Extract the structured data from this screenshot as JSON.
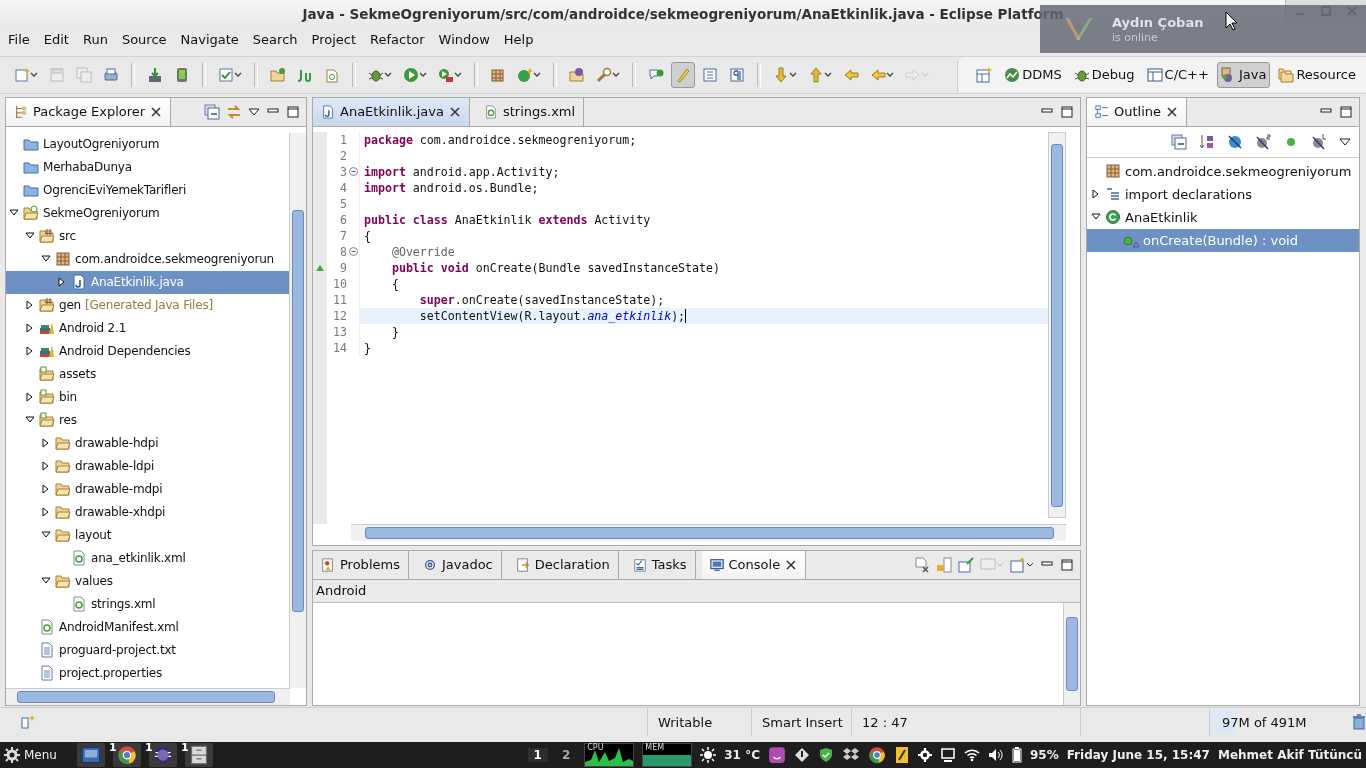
{
  "window": {
    "title": "Java - SekmeOgreniyorum/src/com/androidce/sekmeogreniyorum/AnaEtkinlik.java - Eclipse Platform"
  },
  "notification": {
    "name": "Aydın Çoban",
    "status": "is online"
  },
  "menu": [
    {
      "label": "File"
    },
    {
      "label": "Edit"
    },
    {
      "label": "Run"
    },
    {
      "label": "Source"
    },
    {
      "label": "Navigate"
    },
    {
      "label": "Search"
    },
    {
      "label": "Project"
    },
    {
      "label": "Refactor"
    },
    {
      "label": "Window"
    },
    {
      "label": "Help"
    }
  ],
  "toolbar": {
    "highlight_toggle": {
      "on": true
    }
  },
  "perspectives": [
    {
      "label": "DDMS",
      "kind": "ddms",
      "selected": false
    },
    {
      "label": "Debug",
      "kind": "debug",
      "selected": false
    },
    {
      "label": "C/C++",
      "kind": "cpp",
      "selected": false
    },
    {
      "label": "Java",
      "kind": "java",
      "selected": true
    },
    {
      "label": "Resource",
      "kind": "resource",
      "selected": false
    }
  ],
  "package_explorer": {
    "title": "Package Explorer",
    "tree": [
      {
        "label": "LayoutOgreniyorum",
        "kind": "project",
        "selected": false
      },
      {
        "label": "MerhabaDunya",
        "kind": "project",
        "selected": false
      },
      {
        "label": "OgrenciEviYemekTarifleri",
        "kind": "project",
        "selected": false
      },
      {
        "label": "SekmeOgreniyorum",
        "kind": "androidproject",
        "expanded": true,
        "selected": false,
        "children": [
          {
            "label": "src",
            "kind": "srcfolder",
            "expanded": true,
            "selected": false,
            "children": [
              {
                "label": "com.androidce.sekmeogreniyorun",
                "kind": "package",
                "expanded": true,
                "selected": false,
                "children": [
                  {
                    "label": "AnaEtkinlik.java",
                    "kind": "java",
                    "expanded": false,
                    "selected": true
                  }
                ]
              }
            ]
          },
          {
            "label": "gen",
            "decoration": "[Generated Java Files]",
            "kind": "srcfolder",
            "expanded": false,
            "selected": false
          },
          {
            "label": "Android 2.1",
            "kind": "library",
            "expanded": false,
            "selected": false
          },
          {
            "label": "Android Dependencies",
            "kind": "library",
            "expanded": false,
            "selected": false
          },
          {
            "label": "assets",
            "kind": "resfolder",
            "selected": false
          },
          {
            "label": "bin",
            "kind": "resfolder",
            "expanded": false,
            "selected": false
          },
          {
            "label": "res",
            "kind": "resfolder",
            "expanded": true,
            "selected": false,
            "children": [
              {
                "label": "drawable-hdpi",
                "kind": "folder",
                "expanded": false,
                "selected": false
              },
              {
                "label": "drawable-ldpi",
                "kind": "folder",
                "expanded": false,
                "selected": false
              },
              {
                "label": "drawable-mdpi",
                "kind": "folder",
                "expanded": false,
                "selected": false
              },
              {
                "label": "drawable-xhdpi",
                "kind": "folder",
                "expanded": false,
                "selected": false
              },
              {
                "label": "layout",
                "kind": "folder",
                "expanded": true,
                "selected": false,
                "children": [
                  {
                    "label": "ana_etkinlik.xml",
                    "kind": "xml",
                    "selected": false
                  }
                ]
              },
              {
                "label": "values",
                "kind": "folder",
                "expanded": true,
                "selected": false,
                "children": [
                  {
                    "label": "strings.xml",
                    "kind": "xml",
                    "selected": false
                  }
                ]
              }
            ]
          },
          {
            "label": "AndroidManifest.xml",
            "kind": "xml",
            "selected": false
          },
          {
            "label": "proguard-project.txt",
            "kind": "text",
            "selected": false
          },
          {
            "label": "project.properties",
            "kind": "text",
            "selected": false
          }
        ]
      }
    ]
  },
  "editor": {
    "tabs": [
      {
        "label": "AnaEtkinlik.java",
        "kind": "java",
        "selected": true,
        "closable": true
      },
      {
        "label": "strings.xml",
        "kind": "xml",
        "selected": false,
        "closable": false
      }
    ],
    "lines": [
      {
        "number": "1",
        "tokens": [
          {
            "kind": "keyword",
            "text": "package"
          },
          {
            "kind": "plain",
            "text": " com.androidce.sekmeogreniyorum;"
          }
        ]
      },
      {
        "number": "2"
      },
      {
        "number": "3",
        "foldable": true,
        "tokens": [
          {
            "kind": "keyword",
            "text": "import"
          },
          {
            "kind": "plain",
            "text": " android.app.Activity;"
          }
        ]
      },
      {
        "number": "4",
        "tokens": [
          {
            "kind": "keyword",
            "text": "import"
          },
          {
            "kind": "plain",
            "text": " android.os.Bundle;"
          }
        ]
      },
      {
        "number": "5"
      },
      {
        "number": "6",
        "tokens": [
          {
            "kind": "keyword",
            "text": "public"
          },
          {
            "kind": "keyword",
            "text": " class"
          },
          {
            "kind": "plain",
            "text": " AnaEtkinlik "
          },
          {
            "kind": "keyword",
            "text": "extends"
          },
          {
            "kind": "plain",
            "text": " Activity"
          }
        ]
      },
      {
        "number": "7",
        "tokens": [
          {
            "kind": "plain",
            "text": "{"
          }
        ]
      },
      {
        "number": "8",
        "foldable": true,
        "tokens": [
          {
            "kind": "annotation",
            "text": "    @Override"
          }
        ]
      },
      {
        "number": "9",
        "override": true,
        "tokens": [
          {
            "kind": "keyword",
            "text": "    public"
          },
          {
            "kind": "keyword",
            "text": " void"
          },
          {
            "kind": "plain",
            "text": " onCreate(Bundle savedInstanceState)"
          }
        ]
      },
      {
        "number": "10",
        "tokens": [
          {
            "kind": "plain",
            "text": "    {"
          }
        ]
      },
      {
        "number": "11",
        "tokens": [
          {
            "kind": "keyword",
            "text": "        super"
          },
          {
            "kind": "plain",
            "text": ".onCreate(savedInstanceState);"
          }
        ]
      },
      {
        "number": "12",
        "current": true,
        "tokens": [
          {
            "kind": "plain",
            "text": "        setContentView(R.layout."
          },
          {
            "kind": "field",
            "text": "ana_etkinlik"
          },
          {
            "kind": "plain",
            "text": ");"
          }
        ]
      },
      {
        "number": "13",
        "tokens": [
          {
            "kind": "plain",
            "text": "    }"
          }
        ]
      },
      {
        "number": "14",
        "tokens": [
          {
            "kind": "plain",
            "text": "}"
          }
        ]
      }
    ]
  },
  "console_panel": {
    "tabs": [
      {
        "label": "Problems",
        "kind": "problems",
        "selected": false
      },
      {
        "label": "Javadoc",
        "kind": "javadoc",
        "selected": false
      },
      {
        "label": "Declaration",
        "kind": "declaration",
        "selected": false
      },
      {
        "label": "Tasks",
        "kind": "tasks",
        "selected": false
      },
      {
        "label": "Console",
        "kind": "console",
        "selected": true
      }
    ],
    "console_name": "Android"
  },
  "outline": {
    "title": "Outline",
    "tree": [
      {
        "label": "com.androidce.sekmeogreniyorum",
        "kind": "package",
        "selected": false
      },
      {
        "label": "import declarations",
        "kind": "imports",
        "expanded": false,
        "selected": false
      },
      {
        "label": "AnaEtkinlik",
        "kind": "class",
        "expanded": true,
        "selected": false,
        "children": [
          {
            "label": "onCreate(Bundle) : void",
            "kind": "method",
            "selected": true
          }
        ]
      }
    ]
  },
  "status_bar": {
    "mode": "Writable",
    "insert": "Smart Insert",
    "position": "12 : 47",
    "heap": {
      "text": "97M of 491M",
      "level": 0.18
    }
  },
  "taskbar": {
    "menu": "Menu",
    "apps": [
      {
        "kind": "desktop"
      },
      {
        "kind": "browser",
        "badge": "1"
      },
      {
        "kind": "eclipse",
        "badge": "1"
      },
      {
        "kind": "files",
        "badge": "1"
      }
    ],
    "workspaces": [
      {
        "label": "1",
        "selected": true
      },
      {
        "label": "2",
        "selected": false
      }
    ],
    "cpu": "CPU",
    "mem": "MEM",
    "temperature": "31 °C",
    "battery": "95%",
    "clock": "Friday June 15, 15:47",
    "user": "Mehmet Akif Tütüncü"
  }
}
